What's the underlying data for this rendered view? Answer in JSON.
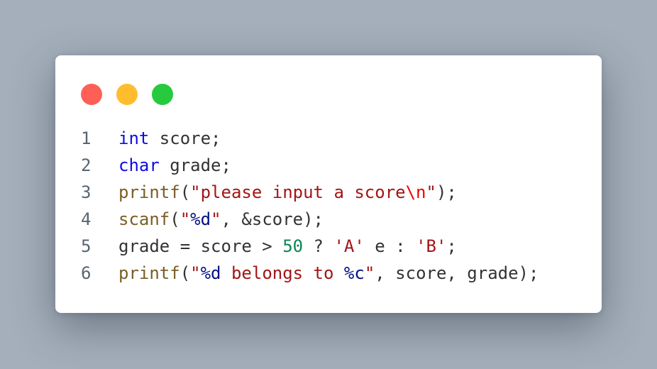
{
  "window": {
    "controls": [
      {
        "name": "close",
        "color": "#ff5f56"
      },
      {
        "name": "minimize",
        "color": "#ffbd2e"
      },
      {
        "name": "zoom",
        "color": "#27c93f"
      }
    ]
  },
  "code": {
    "language": "C",
    "lines": [
      {
        "number": "1",
        "tokens": [
          {
            "text": "int",
            "type": "kw"
          },
          {
            "text": " score;",
            "type": "plain"
          }
        ]
      },
      {
        "number": "2",
        "tokens": [
          {
            "text": "char",
            "type": "kw"
          },
          {
            "text": " grade;",
            "type": "plain"
          }
        ]
      },
      {
        "number": "3",
        "tokens": [
          {
            "text": "printf",
            "type": "fn"
          },
          {
            "text": "(",
            "type": "plain"
          },
          {
            "text": "\"please input a score",
            "type": "str"
          },
          {
            "text": "\\n",
            "type": "esc"
          },
          {
            "text": "\"",
            "type": "str"
          },
          {
            "text": ");",
            "type": "plain"
          }
        ]
      },
      {
        "number": "4",
        "tokens": [
          {
            "text": "scanf",
            "type": "fn"
          },
          {
            "text": "(",
            "type": "plain"
          },
          {
            "text": "\"",
            "type": "str"
          },
          {
            "text": "%d",
            "type": "fmt"
          },
          {
            "text": "\"",
            "type": "str"
          },
          {
            "text": ", &score);",
            "type": "plain"
          }
        ]
      },
      {
        "number": "5",
        "tokens": [
          {
            "text": "grade = score > ",
            "type": "plain"
          },
          {
            "text": "50",
            "type": "num"
          },
          {
            "text": " ? ",
            "type": "plain"
          },
          {
            "text": "'A'",
            "type": "str"
          },
          {
            "text": " e : ",
            "type": "plain"
          },
          {
            "text": "'B'",
            "type": "str"
          },
          {
            "text": ";",
            "type": "plain"
          }
        ]
      },
      {
        "number": "6",
        "tokens": [
          {
            "text": "printf",
            "type": "fn"
          },
          {
            "text": "(",
            "type": "plain"
          },
          {
            "text": "\"",
            "type": "str"
          },
          {
            "text": "%d",
            "type": "fmt"
          },
          {
            "text": " belongs to ",
            "type": "str"
          },
          {
            "text": "%c",
            "type": "fmt"
          },
          {
            "text": "\"",
            "type": "str"
          },
          {
            "text": ", score, grade);",
            "type": "plain"
          }
        ]
      }
    ]
  }
}
